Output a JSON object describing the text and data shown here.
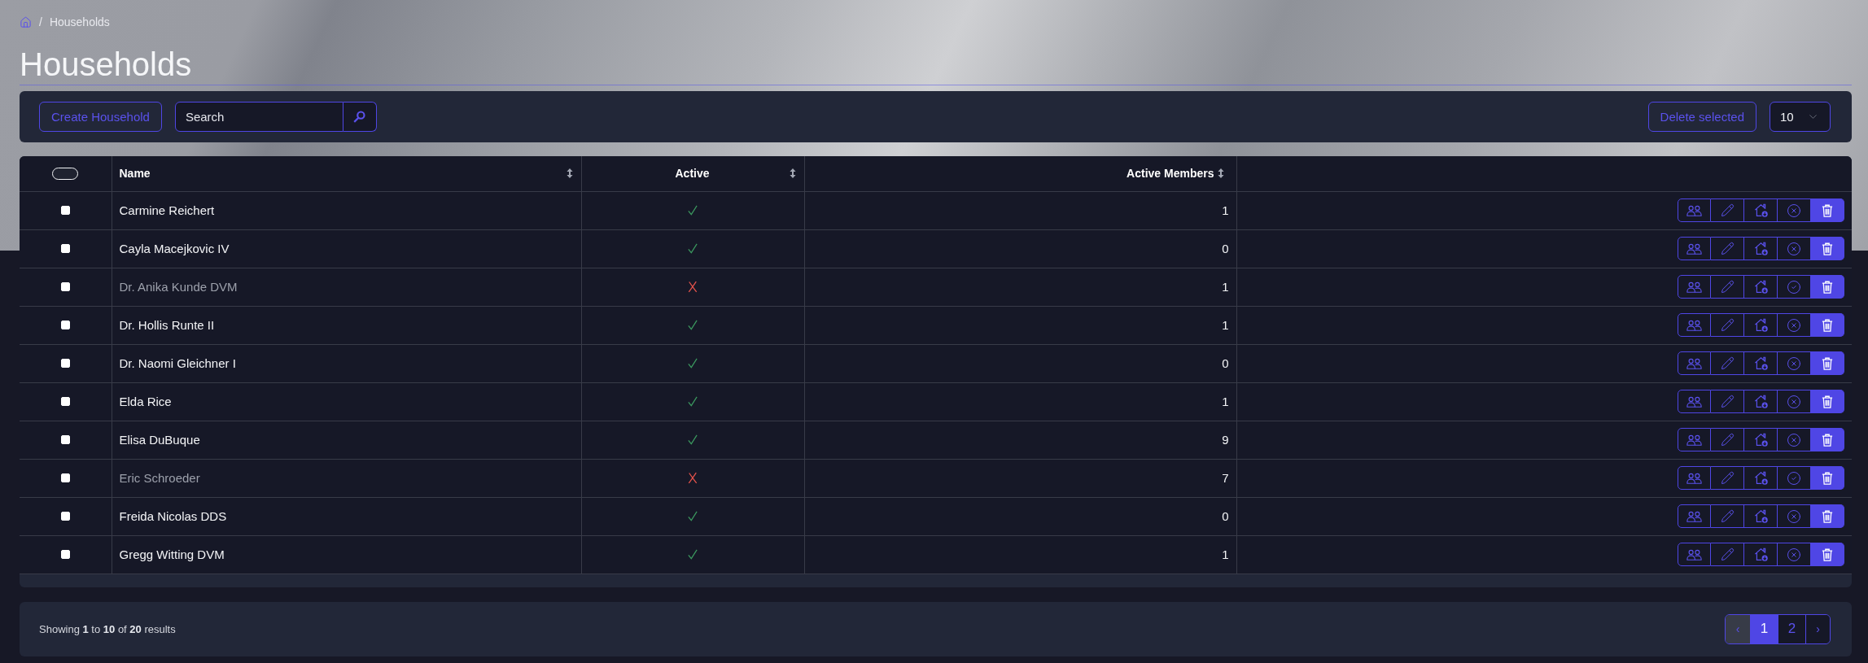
{
  "breadcrumb": {
    "separator": "/",
    "current": "Households"
  },
  "title": "Households",
  "toolbar": {
    "create_button": "Create Household",
    "search": {
      "placeholder": "Search"
    },
    "delete_button": "Delete selected",
    "page_size": "10"
  },
  "table": {
    "select_all": {
      "checked": false
    },
    "columns": [
      {
        "label": "Name",
        "sortable": true
      },
      {
        "label": "Active",
        "sortable": true
      },
      {
        "label": "Active Members",
        "sortable": true
      }
    ],
    "rows": [
      {
        "checked": false,
        "name": "Carmine Reichert",
        "active": true,
        "members": "1"
      },
      {
        "checked": false,
        "name": "Cayla Macejkovic IV",
        "active": true,
        "members": "0"
      },
      {
        "checked": false,
        "name": "Dr. Anika Kunde DVM",
        "active": false,
        "members": "1"
      },
      {
        "checked": false,
        "name": "Dr. Hollis Runte II",
        "active": true,
        "members": "1"
      },
      {
        "checked": false,
        "name": "Dr. Naomi Gleichner I",
        "active": true,
        "members": "0"
      },
      {
        "checked": false,
        "name": "Elda Rice",
        "active": true,
        "members": "1"
      },
      {
        "checked": false,
        "name": "Elisa DuBuque",
        "active": true,
        "members": "9"
      },
      {
        "checked": false,
        "name": "Eric Schroeder",
        "active": false,
        "members": "7"
      },
      {
        "checked": false,
        "name": "Freida Nicolas DDS",
        "active": true,
        "members": "0"
      },
      {
        "checked": false,
        "name": "Gregg Witting DVM",
        "active": true,
        "members": "1"
      }
    ]
  },
  "footer": {
    "summary": "Showing **1** to **10** of **20** results"
  },
  "pagination": {
    "prev": {
      "label": "‹",
      "disabled": true
    },
    "pages": [
      {
        "label": "1",
        "selected": true
      },
      {
        "label": "2",
        "selected": false
      }
    ],
    "next": {
      "label": "›",
      "disabled": false
    }
  }
}
